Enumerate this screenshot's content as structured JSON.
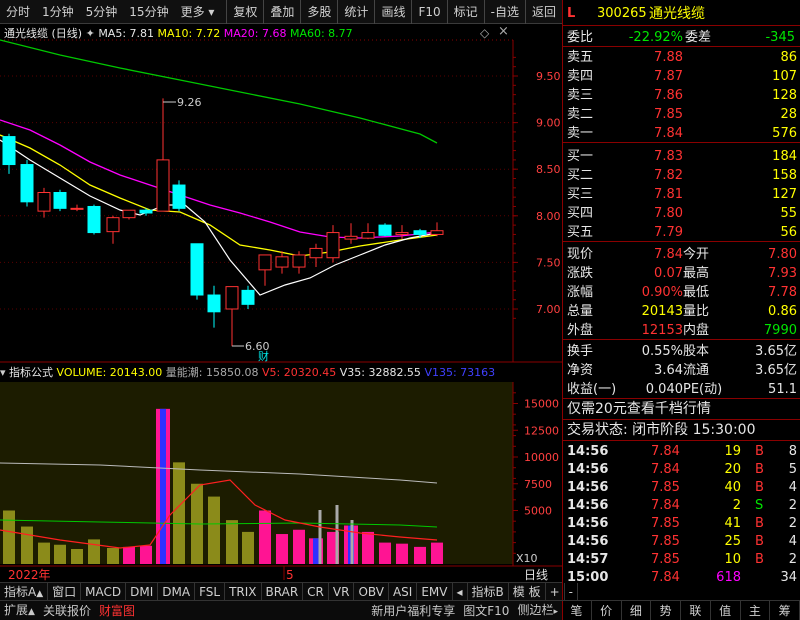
{
  "toolbar": {
    "left_items": [
      "分时",
      "1分钟",
      "5分钟",
      "15分钟",
      "更多"
    ],
    "right_items": [
      "复权",
      "叠加",
      "多股",
      "统计",
      "画线",
      "F10",
      "标记",
      "-自选",
      "返回"
    ]
  },
  "kline": {
    "title": "通光线缆 (日线)",
    "ma5": "MA5: 7.81",
    "ma10": "MA10: 7.72",
    "ma20": "MA20: 7.68",
    "ma60": "MA60: 8.77",
    "high_label": "9.26",
    "low_label": "6.60",
    "cai_label": "财",
    "axis_ticks": [
      "9.50",
      "9.00",
      "8.50",
      "8.00",
      "7.50",
      "7.00"
    ]
  },
  "indicator": {
    "title": "指标公式",
    "volume": "VOLUME: 20143.00",
    "energy": "量能潮: 15850.08",
    "v5": "V5: 20320.45",
    "v35": "V35: 32882.55",
    "v135": "V135: 73163",
    "axis_ticks": [
      "15000",
      "12500",
      "10000",
      "7500",
      "5000"
    ],
    "unit": "X10"
  },
  "time_axis": {
    "year": "2022年",
    "month": "5",
    "period": "日线"
  },
  "bottom_tabs": [
    "指标A",
    "窗口",
    "MACD",
    "DMI",
    "DMA",
    "FSL",
    "TRIX",
    "BRAR",
    "CR",
    "VR",
    "OBV",
    "ASI",
    "EMV",
    "指标B",
    "模 板",
    "+",
    "-"
  ],
  "status_bar": [
    "扩展",
    "关联报价",
    "财富图",
    "新用户福利专享",
    "图文F10",
    "侧边栏"
  ],
  "quote": {
    "flag": "L",
    "code": "300265",
    "name": "通光线缆",
    "weibi_label": "委比",
    "weibi": "-22.92%",
    "weicha_label": "委差",
    "weicha": "-345",
    "asks": [
      {
        "label": "卖五",
        "price": "7.88",
        "vol": "86"
      },
      {
        "label": "卖四",
        "price": "7.87",
        "vol": "107"
      },
      {
        "label": "卖三",
        "price": "7.86",
        "vol": "128"
      },
      {
        "label": "卖二",
        "price": "7.85",
        "vol": "28"
      },
      {
        "label": "卖一",
        "price": "7.84",
        "vol": "576"
      }
    ],
    "bids": [
      {
        "label": "买一",
        "price": "7.83",
        "vol": "184"
      },
      {
        "label": "买二",
        "price": "7.82",
        "vol": "158"
      },
      {
        "label": "买三",
        "price": "7.81",
        "vol": "127"
      },
      {
        "label": "买四",
        "price": "7.80",
        "vol": "55"
      },
      {
        "label": "买五",
        "price": "7.79",
        "vol": "56"
      }
    ],
    "stats": [
      {
        "l1": "现价",
        "v1": "7.84",
        "l2": "今开",
        "v2": "7.80"
      },
      {
        "l1": "涨跌",
        "v1": "0.07",
        "l2": "最高",
        "v2": "7.93"
      },
      {
        "l1": "涨幅",
        "v1": "0.90%",
        "l2": "最低",
        "v2": "7.78"
      },
      {
        "l1": "总量",
        "v1": "20143",
        "l2": "量比",
        "v2": "0.86"
      },
      {
        "l1": "外盘",
        "v1": "12153",
        "l2": "内盘",
        "v2": "7990"
      }
    ],
    "stats2": [
      {
        "l1": "换手",
        "v1": "0.55%",
        "l2": "股本",
        "v2": "3.65亿"
      },
      {
        "l1": "净资",
        "v1": "3.64",
        "l2": "流通",
        "v2": "3.65亿"
      },
      {
        "l1": "收益(一)",
        "v1": "0.040",
        "l2": "PE(动)",
        "v2": "51.1"
      }
    ],
    "promo": "仅需20元查看千档行情",
    "trade_state": "交易状态: 闭市阶段 15:30:00",
    "ticks": [
      {
        "time": "14:56",
        "price": "7.84",
        "vol": "19",
        "bs": "B",
        "n": "8"
      },
      {
        "time": "14:56",
        "price": "7.84",
        "vol": "20",
        "bs": "B",
        "n": "5"
      },
      {
        "time": "14:56",
        "price": "7.85",
        "vol": "40",
        "bs": "B",
        "n": "4"
      },
      {
        "time": "14:56",
        "price": "7.84",
        "vol": "2",
        "bs": "S",
        "n": "2"
      },
      {
        "time": "14:56",
        "price": "7.85",
        "vol": "41",
        "bs": "B",
        "n": "2"
      },
      {
        "time": "14:56",
        "price": "7.85",
        "vol": "25",
        "bs": "B",
        "n": "4"
      },
      {
        "time": "14:57",
        "price": "7.85",
        "vol": "10",
        "bs": "B",
        "n": "2"
      },
      {
        "time": "15:00",
        "price": "7.84",
        "vol": "618",
        "bs": "",
        "n": "34"
      }
    ]
  },
  "nav": [
    "笔",
    "价",
    "细",
    "势",
    "联",
    "值",
    "主",
    "筹"
  ],
  "colors": {
    "up": "#ff3232",
    "down": "#00ffff",
    "ma5": "#ffffff",
    "ma10": "#ffff00",
    "ma20": "#ff00ff",
    "ma60": "#00c800"
  }
}
